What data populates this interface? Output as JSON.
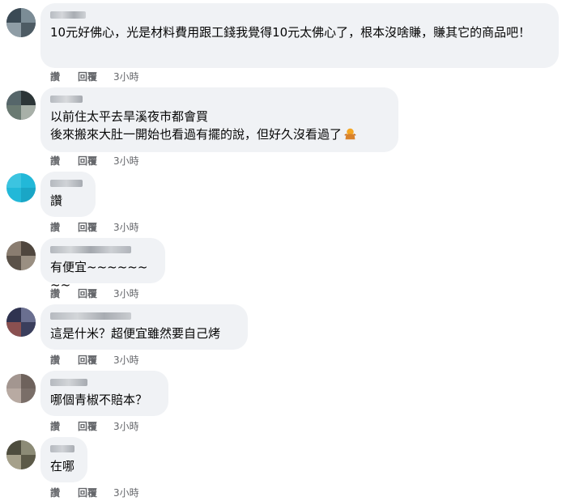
{
  "actions": {
    "like": "讚",
    "reply": "回覆",
    "time": "3小時"
  },
  "comments": [
    {
      "text": "10元好佛心，光是材料費用跟工錢我覺得10元太佛心了，根本沒啥賺，賺其它的商品吧！"
    },
    {
      "text": "以前住太平去旱溪夜市都會買\n後來搬來大肚一開始也看過有擺的說，但好久沒看過了",
      "emoji": "person-shrugging-icon"
    },
    {
      "text": "讚"
    },
    {
      "text": "有便宜~~~~~~~~"
    },
    {
      "text": "這是什米？超便宜雖然要自己烤"
    },
    {
      "text": "哪個青椒不賠本？"
    },
    {
      "text": "在哪"
    }
  ],
  "colors": {
    "bubble": "#f0f2f5",
    "action_text": "#65676b",
    "text": "#050505"
  }
}
